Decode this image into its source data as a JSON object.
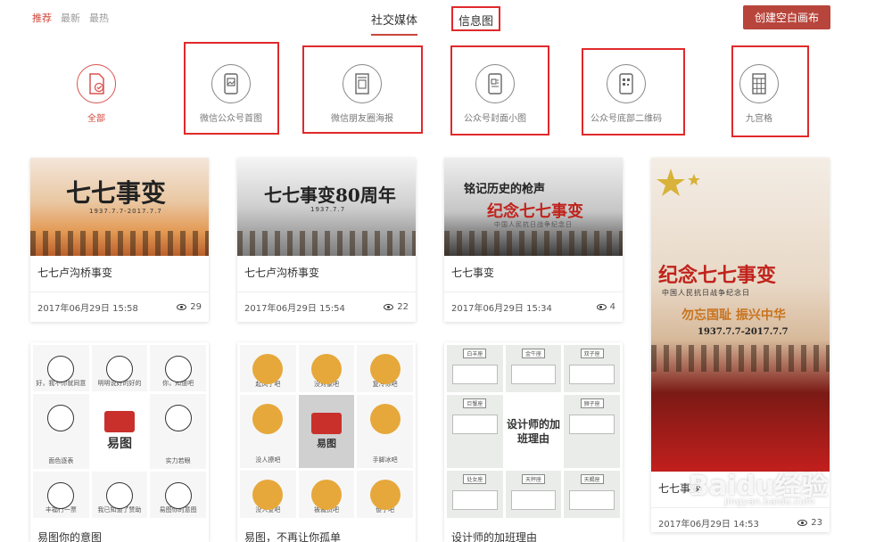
{
  "sort_tabs": [
    "推荐",
    "最新",
    "最热"
  ],
  "category_tabs": {
    "social": "社交媒体",
    "infographic": "信息图"
  },
  "create_button": "创建空白画布",
  "categories": [
    {
      "label": "全部",
      "icon": "doc-check-icon"
    },
    {
      "label": "微信公众号首图",
      "icon": "phone-image-icon"
    },
    {
      "label": "微信朋友圈海报",
      "icon": "poster-icon"
    },
    {
      "label": "公众号封面小图",
      "icon": "cover-thumb-icon"
    },
    {
      "label": "公众号底部二维码",
      "icon": "qr-code-icon"
    },
    {
      "label": "九宫格",
      "icon": "grid-icon"
    }
  ],
  "cards": [
    {
      "title": "七七卢沟桥事变",
      "date": "2017年06月29日 15:58",
      "views": "29",
      "thumb_text": "七七事变",
      "thumb_sub": "1937.7.7-2017.7.7"
    },
    {
      "title": "七七卢沟桥事变",
      "date": "2017年06月29日 15:54",
      "views": "22",
      "thumb_text": "七七事变80周年",
      "thumb_sub": "1937.7.7"
    },
    {
      "title": "七七事变",
      "date": "2017年06月29日 15:34",
      "views": "4",
      "thumb_line1": "铭记历史的枪声",
      "thumb_line2": "纪念七七事变",
      "thumb_sub": "中国人民抗日战争纪念日"
    },
    {
      "title": "七七事变",
      "date": "2017年06月29日 14:53",
      "views": "23",
      "thumb_line1": "纪念七七事变",
      "thumb_line2": "中国人民抗日战争纪念日",
      "thumb_line3": "勿忘国耻 振兴中华",
      "thumb_line4": "1937.7.7-2017.7.7"
    },
    {
      "title": "易图你的意图",
      "cells": [
        "好，我不你就同意",
        "明明说好的好的",
        "你，知道吧",
        "面色逐表",
        "易图",
        "实力若眼",
        "丰福行一票",
        "我已知道了赞助",
        "易图你的意图"
      ]
    },
    {
      "title": "易图，不再让你孤单",
      "cells": [
        "起风了吧",
        "没对象吧",
        "复冷你吧",
        "没人撩吧",
        "易图",
        "手脚冰吧",
        "没人爱吧",
        "被裁员吧",
        "傻了吧"
      ]
    },
    {
      "title": "设计师的加班理由",
      "cells": [
        "白羊座",
        "金牛座",
        "双子座",
        "巨蟹座",
        "设计师的加班理由",
        "狮子座",
        "处女座",
        "天秤座",
        "天蝎座"
      ]
    }
  ],
  "watermark": {
    "brand": "Baidu经验",
    "url": "jingyan.baidu.com"
  },
  "colors": {
    "accent": "#c9473d",
    "highlight": "#e0292b"
  }
}
